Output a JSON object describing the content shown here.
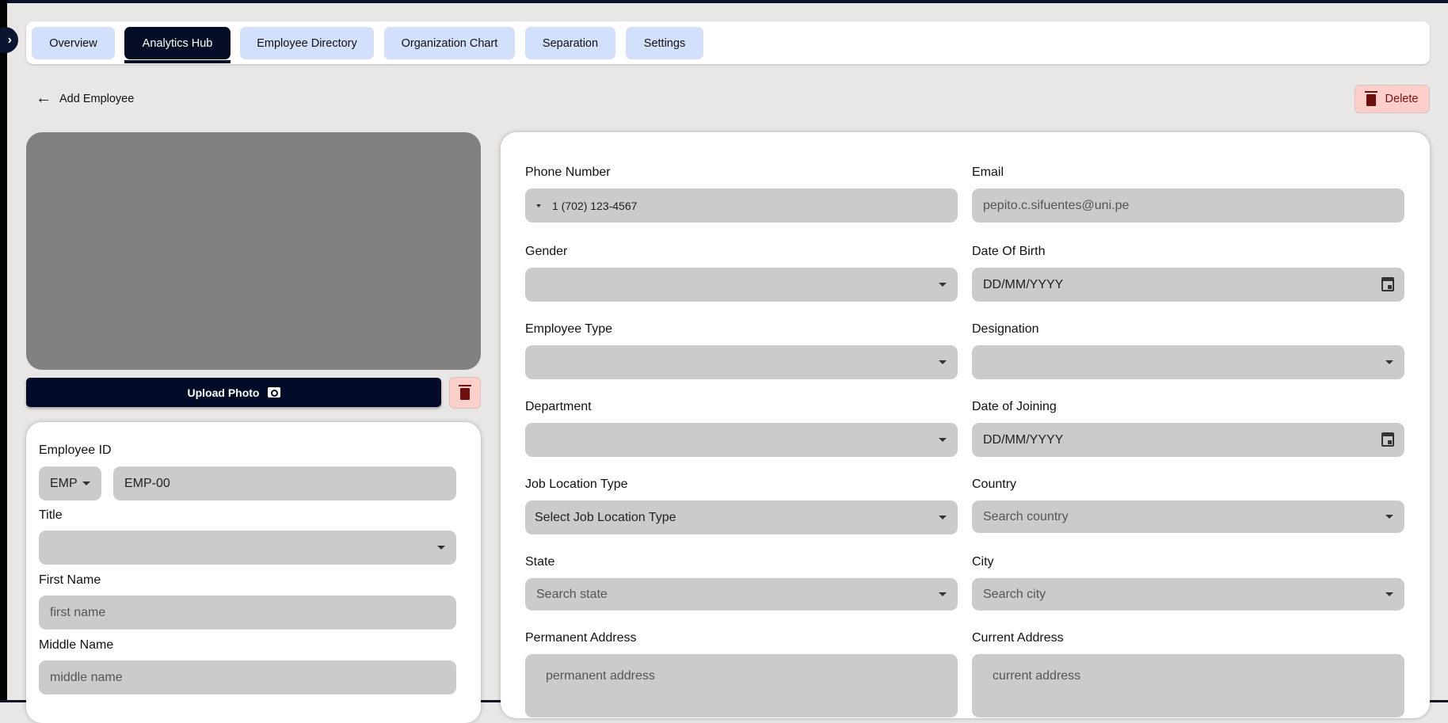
{
  "tabs": [
    {
      "label": "Overview"
    },
    {
      "label": "Analytics Hub",
      "active": true
    },
    {
      "label": "Employee Directory"
    },
    {
      "label": "Organization Chart"
    },
    {
      "label": "Separation"
    },
    {
      "label": "Settings"
    }
  ],
  "header": {
    "back_label": "Add Employee",
    "delete_label": "Delete"
  },
  "photo": {
    "upload_label": "Upload Photo"
  },
  "left_form": {
    "employee_id_label": "Employee ID",
    "prefix_value": "EMP",
    "employee_id_value": "EMP-00",
    "title_label": "Title",
    "title_value": "",
    "first_name_label": "First Name",
    "first_name_placeholder": "first name",
    "middle_name_label": "Middle Name",
    "middle_name_placeholder": "middle name"
  },
  "right_form": {
    "phone_label": "Phone Number",
    "phone_value": "1 (702) 123-4567",
    "email_label": "Email",
    "email_value": "pepito.c.sifuentes@uni.pe",
    "gender_label": "Gender",
    "dob_label": "Date Of Birth",
    "dob_placeholder": "DD/MM/YYYY",
    "employee_type_label": "Employee Type",
    "designation_label": "Designation",
    "department_label": "Department",
    "doj_label": "Date of Joining",
    "doj_placeholder": "DD/MM/YYYY",
    "job_location_label": "Job Location Type",
    "job_location_value": "Select Job Location Type",
    "country_label": "Country",
    "country_placeholder": "Search country",
    "state_label": "State",
    "state_placeholder": "Search state",
    "city_label": "City",
    "city_placeholder": "Search city",
    "permanent_address_label": "Permanent Address",
    "permanent_address_placeholder": "permanent address",
    "current_address_label": "Current Address",
    "current_address_placeholder": "current address"
  }
}
